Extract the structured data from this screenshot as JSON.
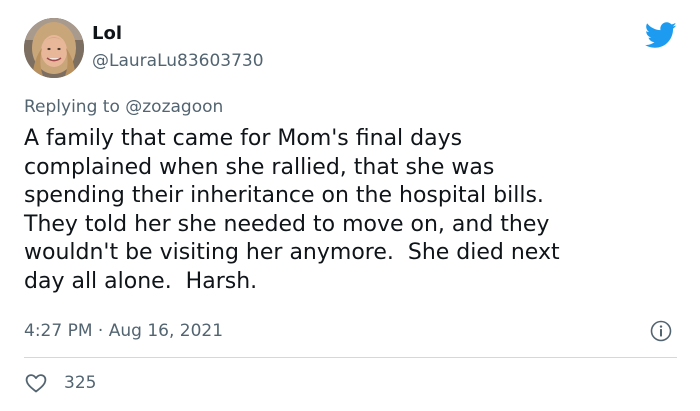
{
  "author": {
    "display_name": "Lol",
    "handle": "@LauraLu83603730"
  },
  "reply": {
    "prefix": "Replying to",
    "mention": "@zozagoon"
  },
  "tweet": {
    "lines": [
      "A family that came for Mom's final days",
      "complained when she rallied, that she was",
      "spending their inheritance on the hospital bills.",
      "They told her she needed to move on, and they",
      "wouldn't be visiting her anymore.  She died next",
      "day all alone.  Harsh."
    ]
  },
  "meta": {
    "time": "4:27 PM",
    "separator": "·",
    "date": "Aug 16, 2021"
  },
  "stats": {
    "likes": "325"
  },
  "icons": {
    "logo": "twitter-bird-icon",
    "info": "info-icon",
    "like": "heart-icon"
  },
  "colors": {
    "brand": "#1d9bf0",
    "text_primary": "#0f1419",
    "text_secondary": "#536471",
    "divider": "#cfd9de"
  }
}
